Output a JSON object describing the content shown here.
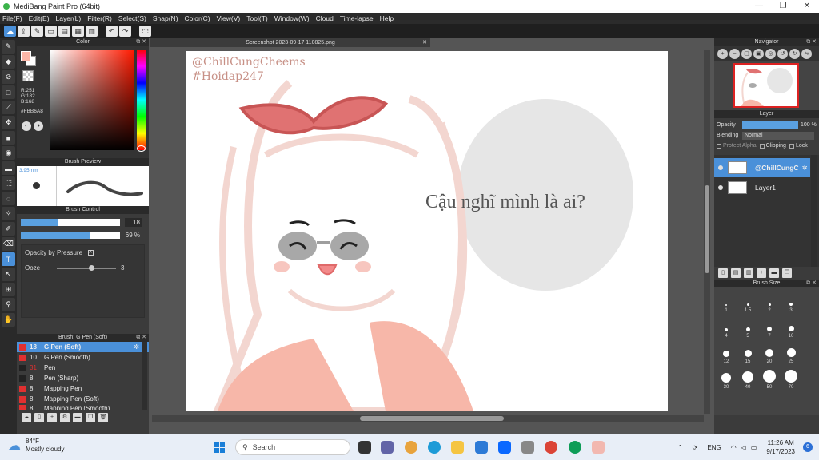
{
  "window": {
    "title": "MediBang Paint Pro (64bit)",
    "controls": [
      "—",
      "❐",
      "✕"
    ]
  },
  "menu": [
    "File(F)",
    "Edit(E)",
    "Layer(L)",
    "Filter(R)",
    "Select(S)",
    "Snap(N)",
    "Color(C)",
    "View(V)",
    "Tool(T)",
    "Window(W)",
    "Cloud",
    "Time-lapse",
    "Help"
  ],
  "panels": {
    "color": {
      "title": "Color",
      "r": "R:251",
      "g": "G:182",
      "b": "B:168",
      "hex": "#FBB6A8",
      "fg_color": "#fbb6a8"
    },
    "brush_preview": {
      "title": "Brush Preview",
      "size": "3.95mm"
    },
    "brush_control": {
      "title": "Brush Control",
      "size_value": "18",
      "size_fill": 0.38,
      "opacity_value": "69 %",
      "opacity_fill": 0.69,
      "opacity_by_pressure": "Opacity by Pressure",
      "ooze_label": "Ooze",
      "ooze_value": "3"
    },
    "brush_list": {
      "title": "Brush: G Pen (Soft)",
      "items": [
        {
          "num": "18",
          "name": "G Pen (Soft)",
          "color": "#e03030",
          "selected": true
        },
        {
          "num": "10",
          "name": "G Pen (Smooth)",
          "color": "#e03030"
        },
        {
          "num": "31",
          "name": "Pen",
          "color": "#222222"
        },
        {
          "num": "8",
          "name": "Pen (Sharp)",
          "color": "#222222"
        },
        {
          "num": "8",
          "name": "Mapping Pen",
          "color": "#e03030"
        },
        {
          "num": "8",
          "name": "Mapping Pen (Soft)",
          "color": "#e03030"
        },
        {
          "num": "8",
          "name": "Mapping Pen (Smooth)",
          "color": "#e03030"
        }
      ]
    },
    "navigator": {
      "title": "Navigator"
    },
    "layer": {
      "title": "Layer",
      "opacity_label": "Opacity",
      "opacity_value": "100 %",
      "blending_label": "Blending",
      "blending_value": "Normal",
      "protect_alpha": "Protect Alpha",
      "clipping": "Clipping",
      "lock": "Lock",
      "layers": [
        {
          "name": "@ChillCungC",
          "selected": true
        },
        {
          "name": "Layer1",
          "selected": false
        }
      ]
    },
    "brush_size": {
      "title": "Brush Size",
      "sizes": [
        "1",
        "1.5",
        "2",
        "3",
        "4",
        "5",
        "7",
        "10",
        "12",
        "15",
        "20",
        "25",
        "30",
        "40",
        "50",
        "70"
      ]
    }
  },
  "document": {
    "tab_title": "Screenshot 2023-09-17 110825.png",
    "watermark_line1": "@ChillCungCheems",
    "watermark_line2": "#Hoidap247",
    "speech_text": "Cậu nghĩ mình là ai?"
  },
  "taskbar": {
    "temperature": "84°F",
    "weather": "Mostly cloudy",
    "search_placeholder": "Search",
    "language": "ENG",
    "time": "11:26 AM",
    "date": "9/17/2023",
    "notifications": "6"
  }
}
